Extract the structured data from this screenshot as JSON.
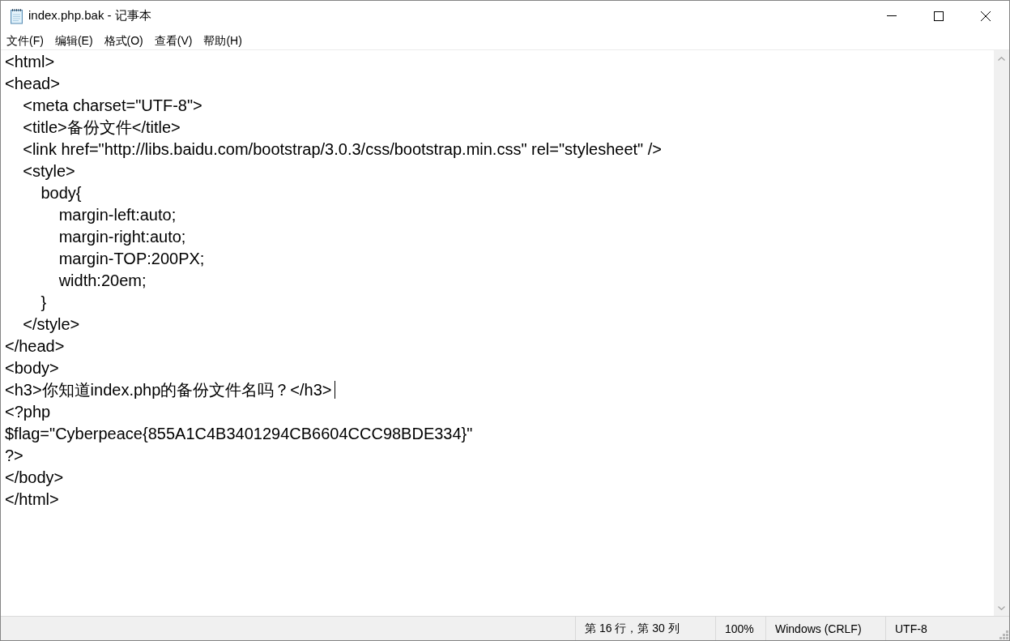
{
  "window": {
    "title": "index.php.bak - 记事本"
  },
  "menu": [
    "文件(F)",
    "编辑(E)",
    "格式(O)",
    "查看(V)",
    "帮助(H)"
  ],
  "editor": {
    "lines": [
      {
        "text": "<html>",
        "caret": false
      },
      {
        "text": "<head>",
        "caret": false
      },
      {
        "text": "    <meta charset=\"UTF-8\">",
        "caret": false
      },
      {
        "text": "    <title>备份文件</title>",
        "caret": false
      },
      {
        "text": "    <link href=\"http://libs.baidu.com/bootstrap/3.0.3/css/bootstrap.min.css\" rel=\"stylesheet\" />",
        "caret": false
      },
      {
        "text": "    <style>",
        "caret": false
      },
      {
        "text": "        body{",
        "caret": false
      },
      {
        "text": "            margin-left:auto;",
        "caret": false
      },
      {
        "text": "            margin-right:auto;",
        "caret": false
      },
      {
        "text": "            margin-TOP:200PX;",
        "caret": false
      },
      {
        "text": "            width:20em;",
        "caret": false
      },
      {
        "text": "        }",
        "caret": false
      },
      {
        "text": "    </style>",
        "caret": false
      },
      {
        "text": "</head>",
        "caret": false
      },
      {
        "text": "<body>",
        "caret": false
      },
      {
        "text": "<h3>你知道index.php的备份文件名吗？</h3>",
        "caret": true
      },
      {
        "text": "<?php",
        "caret": false
      },
      {
        "text": "$flag=\"Cyberpeace{855A1C4B3401294CB6604CCC98BDE334}\"",
        "caret": false
      },
      {
        "text": "?>",
        "caret": false
      },
      {
        "text": "</body>",
        "caret": false
      },
      {
        "text": "</html>",
        "caret": false
      }
    ]
  },
  "status_bar": {
    "cursor_position": "第 16 行，第 30 列",
    "zoom": "100%",
    "line_ending": "Windows (CRLF)",
    "encoding": "UTF-8"
  }
}
